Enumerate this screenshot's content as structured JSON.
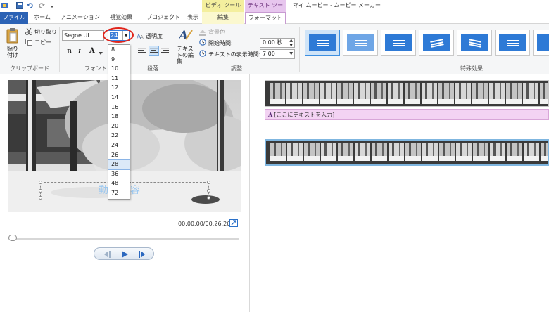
{
  "window": {
    "title": "マイ ムービー - ムービー メーカー",
    "context_tabs": {
      "video_tools": "ビデオ ツール",
      "text_tools": "テキスト ツール"
    }
  },
  "tabs": {
    "file": "ファイル",
    "home": "ホーム",
    "animation": "アニメーション",
    "visual_effects": "視覚効果",
    "project": "プロジェクト",
    "view": "表示",
    "edit": "編集",
    "format": "フォーマット"
  },
  "ribbon": {
    "clipboard": {
      "label": "クリップボード",
      "paste": "貼り付け",
      "cut": "切り取り",
      "copy": "コピー"
    },
    "font": {
      "label": "フォント",
      "family": "Segoe UI",
      "size": "24",
      "transparency": "透明度",
      "bold": "B",
      "italic": "I",
      "font_color": "A"
    },
    "paragraph": {
      "label": "段落"
    },
    "adjust": {
      "label": "調整",
      "edit_text": "テキストの編集",
      "background_color": "背景色",
      "start_time_label": "開始時間:",
      "start_time_value": "0.00 秒",
      "duration_label": "テキストの表示時間:",
      "duration_value": "7.00"
    },
    "effects": {
      "label": "特殊効果"
    }
  },
  "size_options": [
    "8",
    "9",
    "10",
    "11",
    "12",
    "14",
    "16",
    "18",
    "20",
    "22",
    "24",
    "26",
    "28",
    "36",
    "48",
    "72"
  ],
  "size_highlighted": "28",
  "preview": {
    "caption": "動画内容",
    "timecode": "00:00.00/00:26.26"
  },
  "storyboard": {
    "text_track": "[ここにテキストを入力]",
    "text_track_icon": "A"
  },
  "colors": {
    "accent": "#2b62b5",
    "text_tools": "#e7c6ee",
    "video_tools": "#f4ef9e",
    "highlight_circle": "#e0241b"
  }
}
